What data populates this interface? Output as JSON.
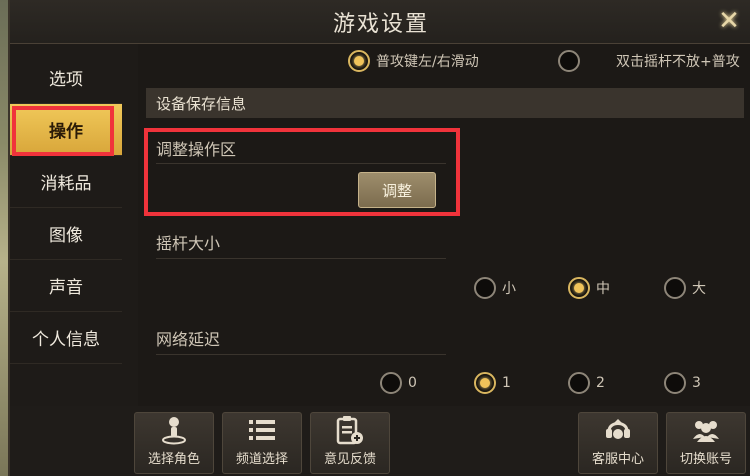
{
  "window": {
    "title": "游戏设置",
    "close_label": "✕"
  },
  "sidebar": {
    "items": [
      {
        "label": "选项",
        "active": false
      },
      {
        "label": "操作",
        "active": true
      },
      {
        "label": "消耗品",
        "active": false
      },
      {
        "label": "图像",
        "active": false
      },
      {
        "label": "声音",
        "active": false
      },
      {
        "label": "个人信息",
        "active": false
      }
    ]
  },
  "content": {
    "top_options": [
      {
        "label": "普攻键左/右滑动",
        "selected": true
      },
      {
        "label": "双击摇杆不放+普攻",
        "selected": false
      }
    ],
    "section_title": "设备保存信息",
    "adjust_area": {
      "label": "调整操作区",
      "button_label": "调整"
    },
    "joystick_size": {
      "label": "摇杆大小",
      "options": [
        {
          "label": "小",
          "selected": false
        },
        {
          "label": "中",
          "selected": true
        },
        {
          "label": "大",
          "selected": false
        }
      ]
    },
    "network_latency": {
      "label": "网络延迟",
      "options": [
        {
          "label": "0",
          "selected": false
        },
        {
          "label": "1",
          "selected": true
        },
        {
          "label": "2",
          "selected": false
        },
        {
          "label": "3",
          "selected": false
        }
      ]
    }
  },
  "bottom_bar": {
    "buttons": [
      {
        "label": "选择角色",
        "icon": "character-icon"
      },
      {
        "label": "频道选择",
        "icon": "list-icon"
      },
      {
        "label": "意见反馈",
        "icon": "feedback-icon"
      },
      {
        "label": "客服中心",
        "icon": "support-icon"
      },
      {
        "label": "切换账号",
        "icon": "switch-account-icon"
      }
    ]
  },
  "colors": {
    "accent_gold": "#f0c35a",
    "highlight_red": "#f0333b"
  }
}
